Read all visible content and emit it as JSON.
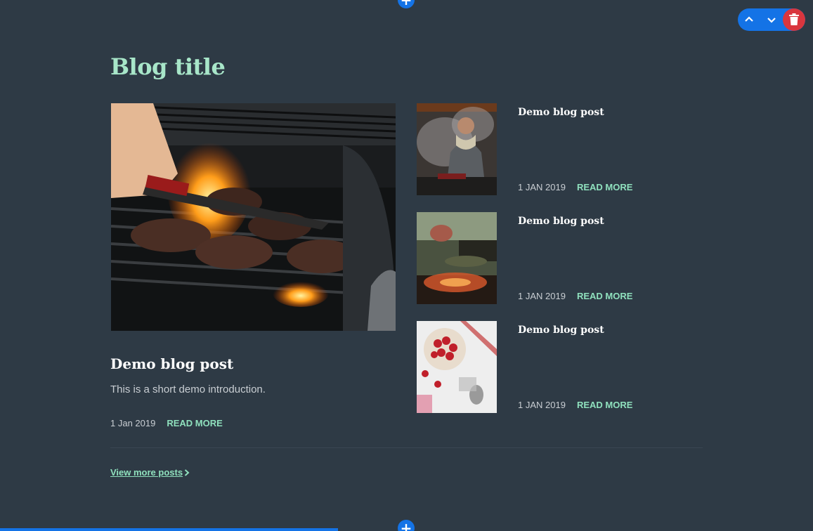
{
  "editor": {
    "add_symbol": "+",
    "toolbar": {
      "move_up_icon": "chevron-up-icon",
      "move_down_icon": "chevron-down-icon",
      "delete_icon": "trash-icon",
      "accent": "#1473e6",
      "danger": "#d9363e"
    }
  },
  "blog": {
    "title": "Blog title",
    "featured": {
      "title": "Demo blog post",
      "intro": "This is a short demo introduction.",
      "date": "1 Jan 2019",
      "read_more": "READ MORE"
    },
    "posts": [
      {
        "title": "Demo blog post",
        "date": "1 JAN 2019",
        "read_more": "READ MORE"
      },
      {
        "title": "Demo blog post",
        "date": "1 JAN 2019",
        "read_more": "READ MORE"
      },
      {
        "title": "Demo blog post",
        "date": "1 JAN 2019",
        "read_more": "READ MORE"
      }
    ],
    "view_more": "View more posts",
    "colors": {
      "background": "#2e3a45",
      "accent": "#8fe0bd",
      "title": "#a8e6c9"
    }
  }
}
